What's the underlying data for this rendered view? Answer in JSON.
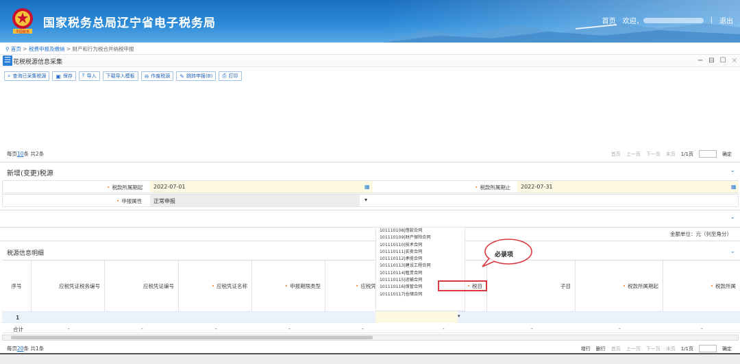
{
  "header": {
    "site_title": "国家税务总局辽宁省电子税务局",
    "emblem_text": "中国税务",
    "home_link": "首页",
    "welcome": "欢迎，",
    "logout": "退出",
    "separator": "|"
  },
  "breadcrumb": {
    "home": "首页",
    "sep1": ">",
    "level1": "税费申报及缴纳",
    "sep2": ">",
    "level2": "财产和行为税合并纳税申报"
  },
  "panel": {
    "title": "花税税源信息采集",
    "minimize": "−",
    "restore": "⊟",
    "maximize": "☐",
    "close": "×"
  },
  "toolbar": {
    "query": "查询已采集税源",
    "save": "保存",
    "import": "导入",
    "download_template": "下载导入模板",
    "void": "作废税源",
    "goto_declare": "跳转申报(B)",
    "print": "打印"
  },
  "pager_top": {
    "prefix": "每页",
    "size": "10",
    "suffix": "条 共2条",
    "first": "首页",
    "prev": "上一页",
    "next": "下一页",
    "last": "末页",
    "page": "1/1页",
    "confirm": "确定"
  },
  "new_source": {
    "heading": "新增(变更)税源",
    "period_start_label": "税款所属期起",
    "period_start": "2022-07-01",
    "period_end_label": "税款所属期止",
    "period_end": "2022-07-31",
    "attr_label": "申报属性",
    "attr_value": "正常申报"
  },
  "units": "金额单位：元（列至角分）",
  "detail": {
    "heading": "税源信息明细",
    "columns": [
      "序号",
      "应税凭证税务编号",
      "应税凭证编号",
      "应税凭证名称",
      "申报期限类型",
      "应税凭",
      "税目",
      "子目",
      "税款所属期起",
      "税款所属"
    ],
    "row_index": "1",
    "total_label": "合计",
    "dash": "-"
  },
  "dropdown_options": [
    "101110108|借款合同",
    "101110109|财产保险合同",
    "101110110|技术合同",
    "101110111|买卖合同",
    "101110112|承揽合同",
    "101110113|建设工程合同",
    "101110114|租赁合同",
    "101110115|运输合同",
    "101110116|保管合同",
    "101110117|仓储合同"
  ],
  "callout": "必录项",
  "pager_bottom": {
    "prefix": "每页",
    "size": "20",
    "suffix": "条 共1条",
    "add_row": "增行",
    "del_row": "删行",
    "first": "首页",
    "prev": "上一页",
    "next": "下一页",
    "last": "末页",
    "page": "1/1页",
    "confirm": "确定"
  },
  "colors": {
    "header_blue": "#1b6fbf",
    "accent": "#2a7fd8",
    "required": "#f08b3c",
    "highlight": "#d9363e",
    "input_bg": "#fdf8e1"
  }
}
